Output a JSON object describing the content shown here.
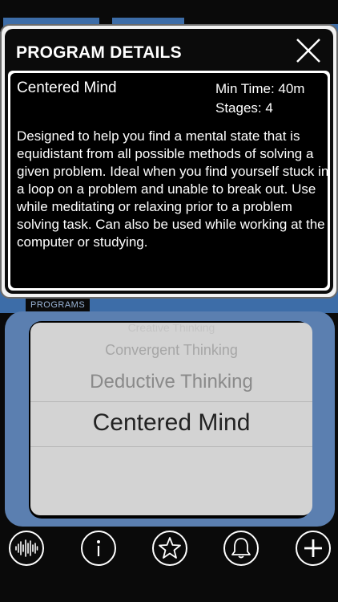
{
  "modal": {
    "title": "PROGRAM DETAILS",
    "program_name": "Centered Mind",
    "min_time": "Min Time: 40m",
    "stages": "Stages: 4",
    "description": "Designed to help you find a mental state that is equidistant from all possible methods of solving a given problem.  Ideal when you find yourself stuck in a loop on a problem and unable to break out.  Use while meditating or relaxing prior to a problem solving task.  Can also be used while working at the computer or studying.",
    "close_icon": "close-icon"
  },
  "programs": {
    "label": "PROGRAMS",
    "items": [
      "Creative Thinking",
      "Convergent Thinking",
      "Deductive Thinking",
      "Centered Mind"
    ],
    "selected": "Centered Mind"
  },
  "toolbar": {
    "icons": [
      "waveform-icon",
      "info-icon",
      "star-icon",
      "bell-icon",
      "plus-icon"
    ]
  },
  "colors": {
    "accent_blue": "#3d6da8",
    "picker_frame": "#5b7fb0",
    "background": "#0a0a0a",
    "picker_bg": "#d3d3d3"
  }
}
